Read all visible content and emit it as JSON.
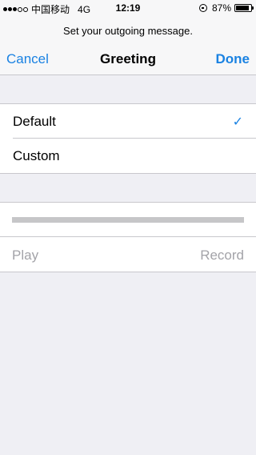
{
  "status_bar": {
    "carrier": "中国移动",
    "network": "4G",
    "time": "12:19",
    "battery": "87%",
    "battery_level": 0.87,
    "signal_bars_filled": 3,
    "signal_bars_total": 5
  },
  "prompt": "Set your outgoing message.",
  "nav": {
    "cancel": "Cancel",
    "title": "Greeting",
    "done": "Done"
  },
  "options": [
    {
      "label": "Default",
      "selected": true
    },
    {
      "label": "Custom",
      "selected": false
    }
  ],
  "player": {
    "progress": 0,
    "play": "Play",
    "record": "Record"
  },
  "colors": {
    "accent": "#1a82e2",
    "disabled": "#a3a3a8",
    "background": "#efeff4"
  },
  "icons": {
    "check": "checkmark-icon"
  }
}
